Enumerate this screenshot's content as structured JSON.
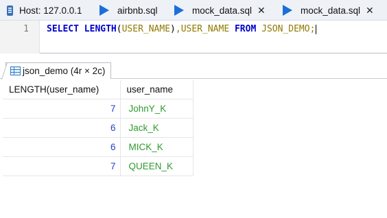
{
  "tabs": [
    {
      "label": "Host: 127.0.0.1",
      "icon": "host-icon",
      "closable": false
    },
    {
      "label": "airbnb.sql",
      "icon": "query-icon",
      "closable": false
    },
    {
      "label": "mock_data.sql",
      "icon": "query-icon",
      "closable": true,
      "close": "✕"
    },
    {
      "label": "mock_data.sql",
      "icon": "query-icon",
      "closable": true,
      "close": "✕"
    }
  ],
  "editor": {
    "line_number": "1",
    "code": {
      "select": "SELECT",
      "length_fn": "LENGTH",
      "open_paren": "(",
      "arg": "USER_NAME",
      "close_paren": ")",
      "comma": ",",
      "col": "USER_NAME",
      "from": "FROM",
      "table": "JSON_DEMO",
      "semicolon": ";"
    }
  },
  "results": {
    "tab_label": "json_demo (4r × 2c)",
    "columns": [
      "LENGTH(user_name)",
      "user_name"
    ],
    "rows": [
      [
        "7",
        "JohnY_K"
      ],
      [
        "6",
        "Jack_K"
      ],
      [
        "6",
        "MICK_K"
      ],
      [
        "7",
        "QUEEN_K"
      ]
    ]
  },
  "colors": {
    "keyword": "#0000cc",
    "identifier": "#8f7a00",
    "number_cell": "#2442c9",
    "string_cell": "#2f9a2f",
    "tab_icon": "#1c6fd8"
  }
}
